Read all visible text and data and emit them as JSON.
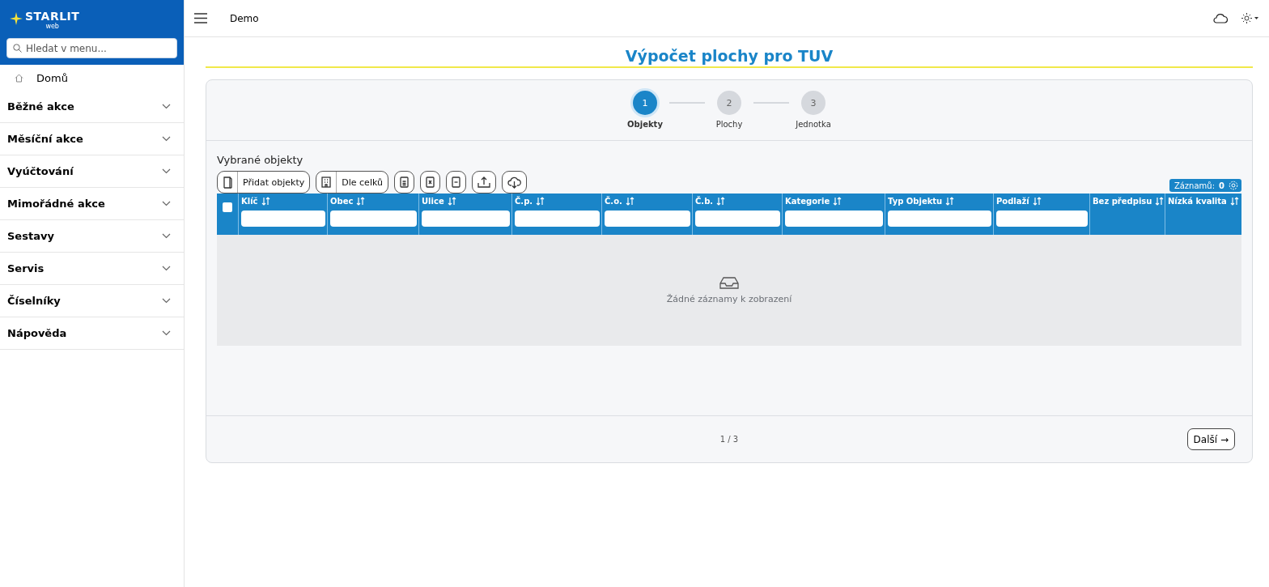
{
  "brand": {
    "name": "STARLIT",
    "sub": "web"
  },
  "sidebar": {
    "search": {
      "placeholder": "Hledat v menu..."
    },
    "items": [
      {
        "label": "Domů",
        "kind": "link"
      },
      {
        "label": "Běžné akce",
        "kind": "group",
        "expanded": false
      },
      {
        "label": "Měsíční akce",
        "kind": "group",
        "expanded": false
      },
      {
        "label": "Vyúčtování",
        "kind": "group",
        "expanded": false
      },
      {
        "label": "Mimořádné akce",
        "kind": "group",
        "expanded": false
      },
      {
        "label": "Sestavy",
        "kind": "group",
        "expanded": false
      },
      {
        "label": "Servis",
        "kind": "group",
        "expanded": false
      },
      {
        "label": "Číselníky",
        "kind": "group",
        "expanded": false
      },
      {
        "label": "Nápověda",
        "kind": "group",
        "expanded": false
      }
    ]
  },
  "topbar": {
    "title": "Demo"
  },
  "page": {
    "title": "Výpočet plochy pro TUV"
  },
  "steps": [
    {
      "number": "1",
      "label": "Objekty",
      "selected": true
    },
    {
      "number": "2",
      "label": "Plochy",
      "selected": false
    },
    {
      "number": "3",
      "label": "Jednotka",
      "selected": false
    }
  ],
  "section_title": "Vybrané objekty",
  "toolbar": [
    {
      "kind": "labeled",
      "label": "Přidat objekty"
    },
    {
      "kind": "labeled",
      "label": "Dle celků"
    },
    {
      "kind": "icon"
    },
    {
      "kind": "icon"
    },
    {
      "kind": "icon"
    },
    {
      "kind": "icon"
    },
    {
      "kind": "icon"
    }
  ],
  "records": {
    "label": "Záznamů:",
    "count": "0"
  },
  "table": {
    "select_all": {
      "checked": false
    },
    "columns": [
      {
        "label": "Klíč",
        "filter": true
      },
      {
        "label": "Obec",
        "filter": true
      },
      {
        "label": "Ulice",
        "filter": true
      },
      {
        "label": "Č.p.",
        "filter": true
      },
      {
        "label": "Č.o.",
        "filter": true
      },
      {
        "label": "Č.b.",
        "filter": true
      },
      {
        "label": "Kategorie",
        "filter": true
      },
      {
        "label": "Typ Objektu",
        "filter": true
      },
      {
        "label": "Podlaží",
        "filter": true
      },
      {
        "label": "Bez předpisu",
        "filter": false
      },
      {
        "label": "Nízká kvalita",
        "filter": false
      }
    ],
    "empty": "Žádné záznamy k zobrazení"
  },
  "footer": {
    "pager": "1 / 3",
    "next": "Další →"
  }
}
